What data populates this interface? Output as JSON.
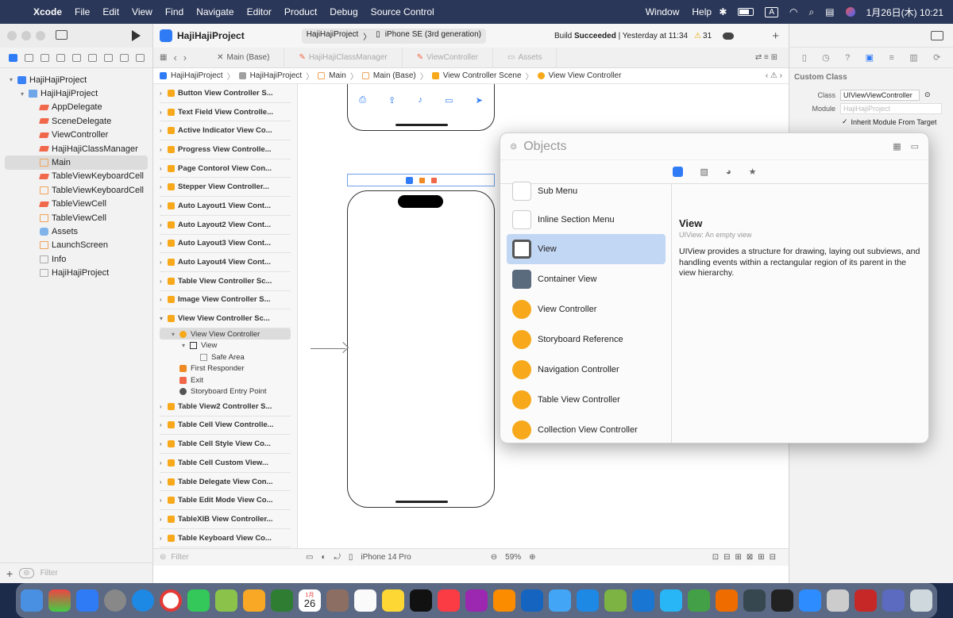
{
  "menubar": {
    "app": "Xcode",
    "items": [
      "File",
      "Edit",
      "View",
      "Find",
      "Navigate",
      "Editor",
      "Product",
      "Debug",
      "Source Control",
      "Window",
      "Help"
    ],
    "date_time": "1月26日(木) 10:21",
    "input_label": "A"
  },
  "toolbar": {
    "project": "HajiHajiProject",
    "scheme": "HajiHajiProject",
    "device": "iPhone SE (3rd generation)",
    "status_prefix": "Build ",
    "status_bold": "Succeeded",
    "status_suffix": " | Yesterday at 11:34",
    "warnings": "31"
  },
  "tabs": [
    "Main (Base)",
    "HajiHajiClassManager",
    "ViewController",
    "Assets"
  ],
  "jumpbar": [
    "HajiHajiProject",
    "HajiHajiProject",
    "Main",
    "Main (Base)",
    "View Controller Scene",
    "View View Controller"
  ],
  "navigator": {
    "items": [
      {
        "label": "HajiHajiProject",
        "icon": "proj",
        "indent": 0,
        "chev": "▾"
      },
      {
        "label": "HajiHajiProject",
        "icon": "folder",
        "indent": 1,
        "chev": "▾"
      },
      {
        "label": "AppDelegate",
        "icon": "swift",
        "indent": 2,
        "chev": ""
      },
      {
        "label": "SceneDelegate",
        "icon": "swift",
        "indent": 2,
        "chev": ""
      },
      {
        "label": "ViewController",
        "icon": "swift",
        "indent": 2,
        "chev": ""
      },
      {
        "label": "HajiHajiClassManager",
        "icon": "swift",
        "indent": 2,
        "chev": ""
      },
      {
        "label": "Main",
        "icon": "sb",
        "indent": 2,
        "chev": "",
        "selected": true
      },
      {
        "label": "TableViewKeyboardCell",
        "icon": "swift",
        "indent": 2,
        "chev": ""
      },
      {
        "label": "TableViewKeyboardCell",
        "icon": "sb",
        "indent": 2,
        "chev": ""
      },
      {
        "label": "TableViewCell",
        "icon": "swift",
        "indent": 2,
        "chev": ""
      },
      {
        "label": "TableViewCell",
        "icon": "sb",
        "indent": 2,
        "chev": ""
      },
      {
        "label": "Assets",
        "icon": "assets",
        "indent": 2,
        "chev": ""
      },
      {
        "label": "LaunchScreen",
        "icon": "sb",
        "indent": 2,
        "chev": ""
      },
      {
        "label": "Info",
        "icon": "plist",
        "indent": 2,
        "chev": ""
      },
      {
        "label": "HajiHajiProject",
        "icon": "plist",
        "indent": 2,
        "chev": ""
      }
    ],
    "filter_placeholder": "Filter"
  },
  "outline": {
    "scenes_top": [
      "Button View Controller S...",
      "Text Field View Controlle...",
      "Active Indicator View Co...",
      "Progress View Controlle...",
      "Page Contorol View Con...",
      "Stepper View Controller...",
      "Auto Layout1 View Cont...",
      "Auto Layout2 View Cont...",
      "Auto Layout3 View Cont...",
      "Auto Layout4 View Cont...",
      "Table View Controller Sc...",
      "Image View Controller S...",
      "View View Controller Sc..."
    ],
    "expanded": [
      {
        "label": "View View Controller",
        "indent": 1,
        "chev": "▾",
        "icon": "vc",
        "selected": true
      },
      {
        "label": "View",
        "indent": 2,
        "chev": "▾",
        "icon": "view"
      },
      {
        "label": "Safe Area",
        "indent": 3,
        "chev": "",
        "icon": "safe"
      },
      {
        "label": "First Responder",
        "indent": 1,
        "chev": "",
        "icon": "fr"
      },
      {
        "label": "Exit",
        "indent": 1,
        "chev": "",
        "icon": "exit"
      },
      {
        "label": "Storyboard Entry Point",
        "indent": 1,
        "chev": "",
        "icon": "entry"
      }
    ],
    "scenes_bottom": [
      "Table View2 Controller S...",
      "Table Cell View Controlle...",
      "Table Cell Style View Co...",
      "Table Cell Custom View...",
      "Table Delegate View Con...",
      "Table Edit Mode View Co...",
      "TableXIB View Controller...",
      "Table Keyboard View Co..."
    ],
    "filter_placeholder": "Filter"
  },
  "canvas_footer": {
    "device": "iPhone 14 Pro",
    "zoom": "59%"
  },
  "library": {
    "title": "Objects",
    "items": [
      "Sub Menu",
      "Inline Section Menu",
      "View",
      "Container View",
      "View Controller",
      "Storyboard Reference",
      "Navigation Controller",
      "Table View Controller",
      "Collection View Controller"
    ],
    "selected_index": 2,
    "detail": {
      "title": "View",
      "subtitle": "UIView: An empty view",
      "body": "UIView provides a structure for drawing, laying out subviews, and handling events within a rectangular region of its parent in the view hierarchy."
    }
  },
  "inspector": {
    "section": "Custom Class",
    "class_label": "Class",
    "class_value": "UIViewViewController",
    "module_label": "Module",
    "module_placeholder": "HajiHajiProject",
    "inherit_label": "Inherit Module From Target"
  },
  "dock": {
    "calendar_month": "1月",
    "calendar_day": "26"
  }
}
